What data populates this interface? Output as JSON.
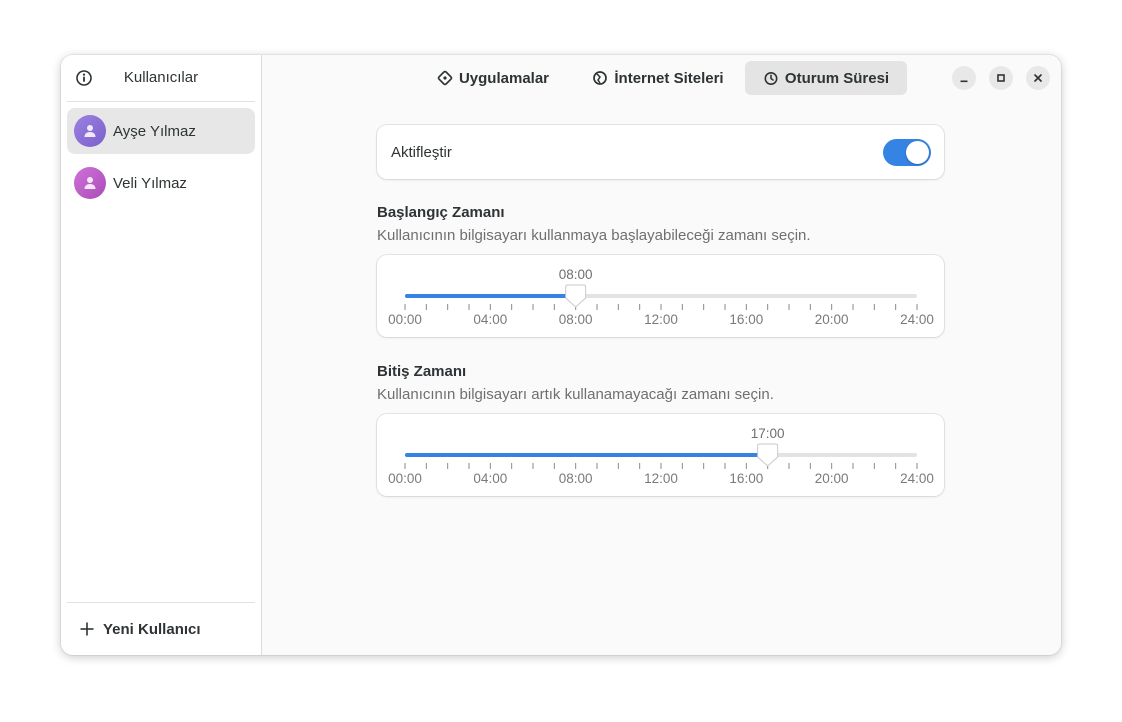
{
  "sidebar": {
    "title": "Kullanıcılar",
    "info_icon": "info-icon",
    "users": [
      {
        "name": "Ayşe Yılmaz",
        "selected": true,
        "avatar_color": "#8b6fd6"
      },
      {
        "name": "Veli Yılmaz",
        "selected": false,
        "avatar_color": "#c061cb"
      }
    ],
    "new_user_label": "Yeni Kullanıcı"
  },
  "tabs": [
    {
      "label": "Uygulamalar",
      "icon": "apps-icon",
      "active": false
    },
    {
      "label": "İnternet Siteleri",
      "icon": "globe-icon",
      "active": false
    },
    {
      "label": "Oturum Süresi",
      "icon": "clock-icon",
      "active": true
    }
  ],
  "window_controls": [
    "minimize-icon",
    "maximize-icon",
    "close-icon"
  ],
  "enable": {
    "label": "Aktifleştir",
    "on": true
  },
  "start": {
    "title": "Başlangıç Zamanı",
    "description": "Kullanıcının bilgisayarı kullanmaya başlayabileceği zamanı seçin.",
    "value_label": "08:00",
    "value_hours": 8
  },
  "end": {
    "title": "Bitiş Zamanı",
    "description": "Kullanıcının bilgisayarı artık kullanamayacağı zamanı seçin.",
    "value_label": "17:00",
    "value_hours": 17
  },
  "slider_scale": {
    "min_hours": 0,
    "max_hours": 24,
    "tick_labels": [
      "00:00",
      "04:00",
      "08:00",
      "12:00",
      "16:00",
      "20:00",
      "24:00"
    ]
  },
  "colors": {
    "accent": "#3584e4",
    "trough": "#e3e3e3"
  }
}
